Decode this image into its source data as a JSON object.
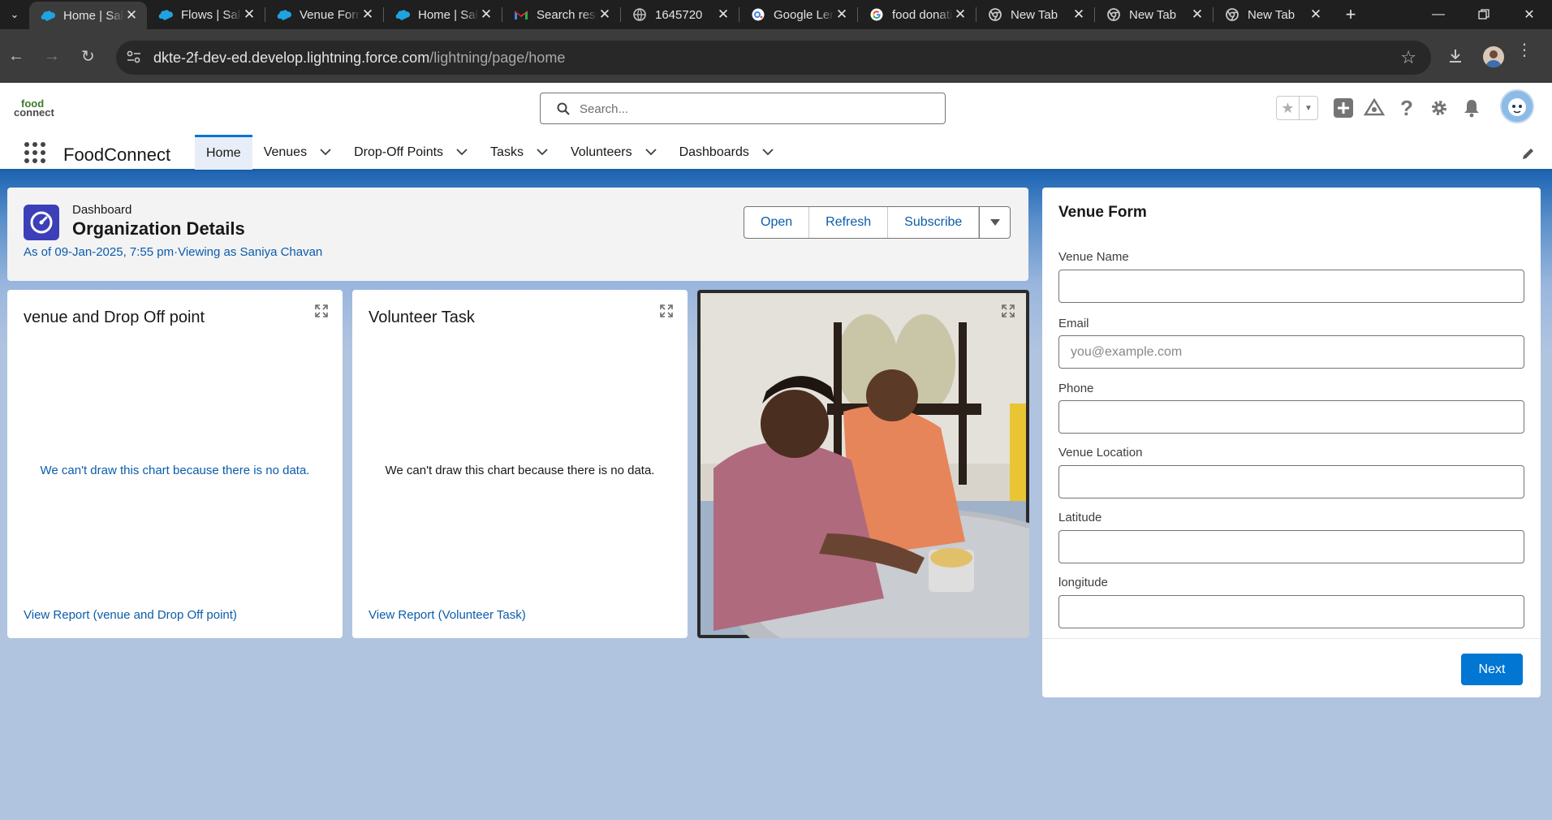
{
  "browser": {
    "tabs": [
      {
        "title": "Home | Salesforce",
        "icon": "salesforce-cloud-icon",
        "active": true
      },
      {
        "title": "Flows | Salesforce",
        "icon": "salesforce-cloud-icon",
        "active": false
      },
      {
        "title": "Venue Form",
        "icon": "salesforce-cloud-icon",
        "active": false
      },
      {
        "title": "Home | Salesforce",
        "icon": "salesforce-cloud-icon",
        "active": false
      },
      {
        "title": "Search results",
        "icon": "gmail-icon",
        "active": false
      },
      {
        "title": "1645720",
        "icon": "globe-icon",
        "active": false
      },
      {
        "title": "Google Lens",
        "icon": "google-lens-icon",
        "active": false
      },
      {
        "title": "food donation",
        "icon": "google-icon",
        "active": false
      },
      {
        "title": "New Tab",
        "icon": "chrome-icon",
        "active": false
      },
      {
        "title": "New Tab",
        "icon": "chrome-icon",
        "active": false
      },
      {
        "title": "New Tab",
        "icon": "chrome-icon",
        "active": false
      }
    ],
    "url_host": "dkte-2f-dev-ed.develop.lightning.force.com",
    "url_path": "/lightning/page/home"
  },
  "header": {
    "logo_line1": "food",
    "logo_line2": "connect",
    "search_placeholder": "Search..."
  },
  "nav": {
    "app_name": "FoodConnect",
    "items": [
      {
        "label": "Home",
        "active": true,
        "has_menu": false
      },
      {
        "label": "Venues",
        "active": false,
        "has_menu": true
      },
      {
        "label": "Drop-Off Points",
        "active": false,
        "has_menu": true
      },
      {
        "label": "Tasks",
        "active": false,
        "has_menu": true
      },
      {
        "label": "Volunteers",
        "active": false,
        "has_menu": true
      },
      {
        "label": "Dashboards",
        "active": false,
        "has_menu": true
      }
    ]
  },
  "dashboard": {
    "kind": "Dashboard",
    "title": "Organization Details",
    "meta": "As of 09-Jan-2025, 7:55 pm·Viewing as Saniya Chavan",
    "buttons": {
      "open": "Open",
      "refresh": "Refresh",
      "subscribe": "Subscribe"
    }
  },
  "cards": [
    {
      "title": "venue and Drop Off point",
      "no_data": "We can't draw this chart because there is no data.",
      "report_link": "View Report (venue and Drop Off point)",
      "no_data_color": "#0b5cab"
    },
    {
      "title": "Volunteer Task",
      "no_data": "We can't draw this chart because there is no data.",
      "report_link": "View Report (Volunteer Task)",
      "no_data_color": "#181818"
    }
  ],
  "venue_form": {
    "title": "Venue Form",
    "fields": [
      {
        "label": "Venue Name",
        "value": "",
        "placeholder": ""
      },
      {
        "label": "Email",
        "value": "",
        "placeholder": "you@example.com"
      },
      {
        "label": "Phone",
        "value": "",
        "placeholder": ""
      },
      {
        "label": "Venue Location",
        "value": "",
        "placeholder": ""
      },
      {
        "label": "Latitude",
        "value": "",
        "placeholder": ""
      },
      {
        "label": "longitude",
        "value": "",
        "placeholder": ""
      }
    ],
    "next_label": "Next"
  },
  "colors": {
    "brand_blue": "#0176d3",
    "link_blue": "#0b5cab",
    "dashboard_icon": "#3c3fb8"
  }
}
